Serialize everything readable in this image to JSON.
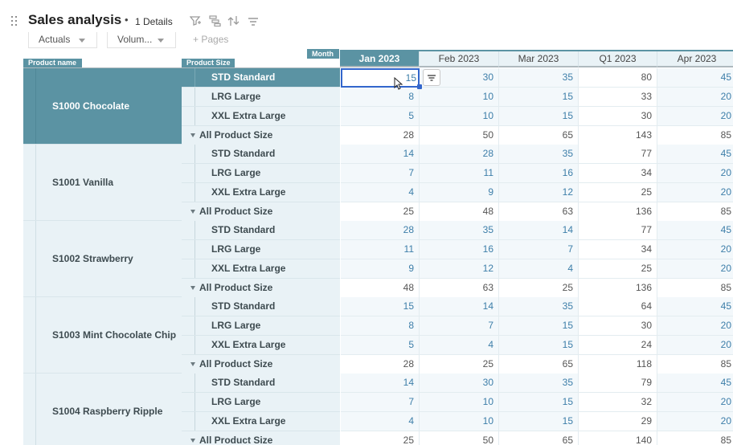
{
  "header": {
    "title": "Sales analysis",
    "separator": "•",
    "details": "1 Details",
    "pages": {
      "actuals": "Actuals",
      "volume": "Volum...",
      "add_pages": "+ Pages"
    }
  },
  "grid": {
    "row_dim_1": "Product name",
    "row_dim_2": "Product Size",
    "col_dim": "Month",
    "columns": [
      "Jan 2023",
      "Feb 2023",
      "Mar 2023",
      "Q1 2023",
      "Apr 2023"
    ],
    "products": [
      {
        "name": "S1000 Chocolate",
        "rows": [
          {
            "size": "STD Standard",
            "values": [
              "15",
              "30",
              "35",
              "80",
              "45"
            ]
          },
          {
            "size": "LRG Large",
            "values": [
              "8",
              "10",
              "15",
              "33",
              "20"
            ]
          },
          {
            "size": "XXL Extra Large",
            "values": [
              "5",
              "10",
              "15",
              "30",
              "20"
            ]
          },
          {
            "size": "All Product Size",
            "values": [
              "28",
              "50",
              "65",
              "143",
              "85"
            ]
          }
        ]
      },
      {
        "name": "S1001 Vanilla",
        "rows": [
          {
            "size": "STD Standard",
            "values": [
              "14",
              "28",
              "35",
              "77",
              "45"
            ]
          },
          {
            "size": "LRG Large",
            "values": [
              "7",
              "11",
              "16",
              "34",
              "20"
            ]
          },
          {
            "size": "XXL Extra Large",
            "values": [
              "4",
              "9",
              "12",
              "25",
              "20"
            ]
          },
          {
            "size": "All Product Size",
            "values": [
              "25",
              "48",
              "63",
              "136",
              "85"
            ]
          }
        ]
      },
      {
        "name": "S1002 Strawberry",
        "rows": [
          {
            "size": "STD Standard",
            "values": [
              "28",
              "35",
              "14",
              "77",
              "45"
            ]
          },
          {
            "size": "LRG Large",
            "values": [
              "11",
              "16",
              "7",
              "34",
              "20"
            ]
          },
          {
            "size": "XXL Extra Large",
            "values": [
              "9",
              "12",
              "4",
              "25",
              "20"
            ]
          },
          {
            "size": "All Product Size",
            "values": [
              "48",
              "63",
              "25",
              "136",
              "85"
            ]
          }
        ]
      },
      {
        "name": "S1003 Mint Chocolate Chip",
        "rows": [
          {
            "size": "STD Standard",
            "values": [
              "15",
              "14",
              "35",
              "64",
              "45"
            ]
          },
          {
            "size": "LRG Large",
            "values": [
              "8",
              "7",
              "15",
              "30",
              "20"
            ]
          },
          {
            "size": "XXL Extra Large",
            "values": [
              "5",
              "4",
              "15",
              "24",
              "20"
            ]
          },
          {
            "size": "All Product Size",
            "values": [
              "28",
              "25",
              "65",
              "118",
              "85"
            ]
          }
        ]
      },
      {
        "name": "S1004 Raspberry Ripple",
        "rows": [
          {
            "size": "STD Standard",
            "values": [
              "14",
              "30",
              "35",
              "79",
              "45"
            ]
          },
          {
            "size": "LRG Large",
            "values": [
              "7",
              "10",
              "15",
              "32",
              "20"
            ]
          },
          {
            "size": "XXL Extra Large",
            "values": [
              "4",
              "10",
              "15",
              "29",
              "20"
            ]
          },
          {
            "size": "All Product Size",
            "values": [
              "25",
              "50",
              "65",
              "140",
              "85"
            ]
          }
        ]
      }
    ]
  },
  "colors": {
    "accent": "#5b93a3",
    "header_bg": "#e9f2f6",
    "input_text": "#3d7ea9",
    "selection": "#3366cc"
  },
  "icons": [
    "drag-handle-icon",
    "filter-icon",
    "hierarchy-icon",
    "pivot-icon",
    "options-icon",
    "cell-options-icon"
  ]
}
